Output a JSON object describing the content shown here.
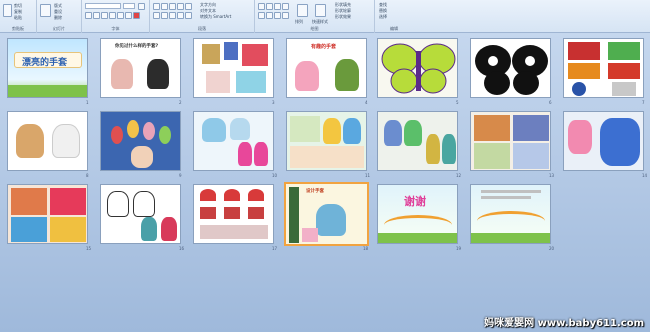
{
  "ribbon": {
    "groups": [
      {
        "label": "剪贴板"
      },
      {
        "label": "幻灯片"
      },
      {
        "label": "字体"
      },
      {
        "label": "段落"
      },
      {
        "label": "绘图"
      },
      {
        "label": "编辑"
      }
    ],
    "clipboard_items": [
      "剪切",
      "复制",
      "粘贴"
    ],
    "slide_items": [
      "版式",
      "重设",
      "删除"
    ],
    "paragraph_items": [
      "文字方向",
      "对齐文本",
      "转换为 SmartArt"
    ],
    "drawing_items": [
      "排列",
      "快速样式"
    ],
    "shape_items": [
      "形状填充",
      "形状轮廓",
      "形状效果"
    ],
    "editing_items": [
      "查找",
      "替换",
      "选择"
    ]
  },
  "slides": [
    {
      "num": "1",
      "title": "漂亮的手套"
    },
    {
      "num": "2",
      "title": "你见过什么样的手套?"
    },
    {
      "num": "3",
      "title": ""
    },
    {
      "num": "4",
      "title": "有趣的手套"
    },
    {
      "num": "5",
      "title": ""
    },
    {
      "num": "6",
      "title": ""
    },
    {
      "num": "7",
      "title": ""
    },
    {
      "num": "8",
      "title": ""
    },
    {
      "num": "9",
      "title": ""
    },
    {
      "num": "10",
      "title": ""
    },
    {
      "num": "11",
      "title": ""
    },
    {
      "num": "12",
      "title": ""
    },
    {
      "num": "13",
      "title": ""
    },
    {
      "num": "14",
      "title": ""
    },
    {
      "num": "15",
      "title": ""
    },
    {
      "num": "16",
      "title": ""
    },
    {
      "num": "17",
      "title": ""
    },
    {
      "num": "18",
      "title": "设计手套"
    },
    {
      "num": "19",
      "title": "谢谢"
    },
    {
      "num": "20",
      "title": ""
    }
  ],
  "watermark": "妈咪爱婴网 www.baby611.com",
  "colors": {
    "selection": "#f1a340",
    "workspace_top": "#c5d7ee",
    "workspace_bottom": "#9fb9db"
  }
}
